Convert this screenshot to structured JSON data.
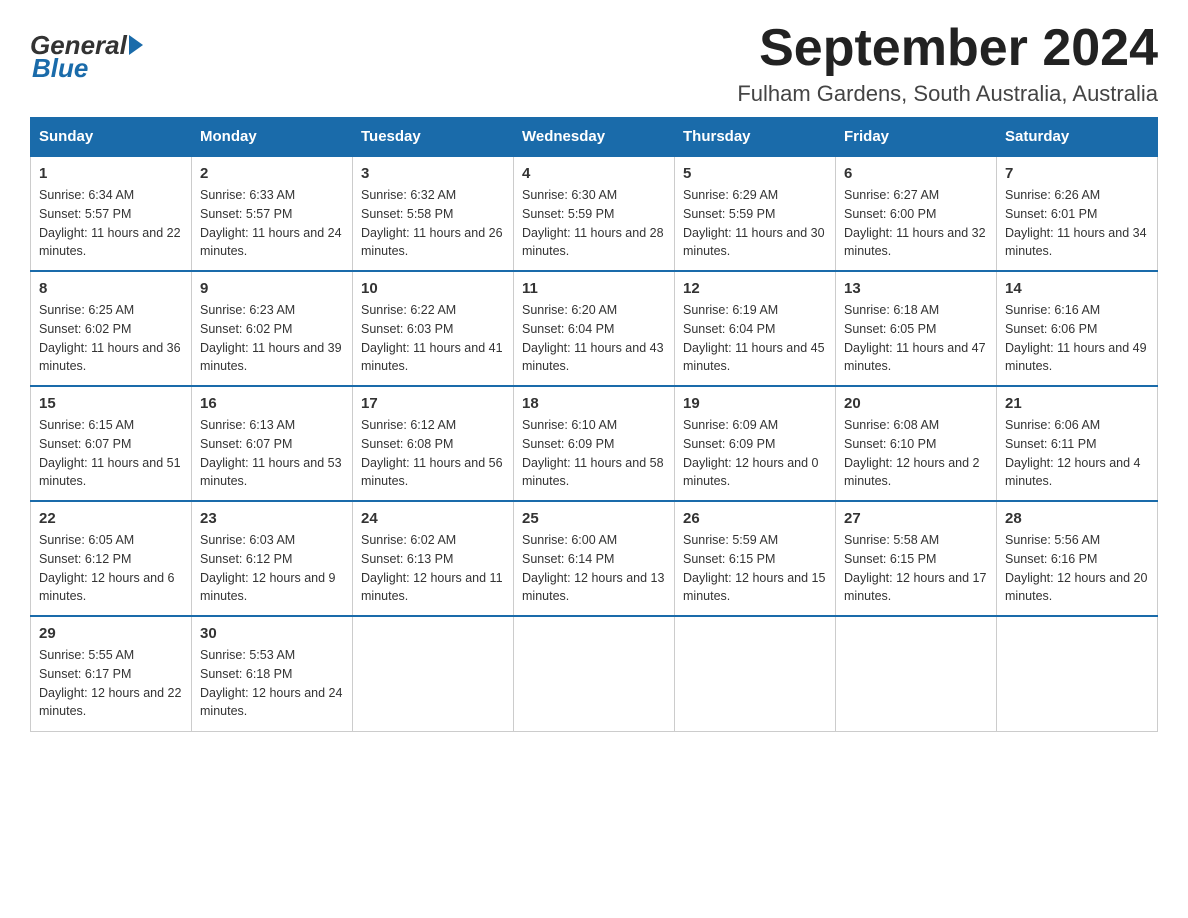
{
  "header": {
    "logo": {
      "general": "General",
      "blue": "Blue"
    },
    "month_title": "September 2024",
    "location": "Fulham Gardens, South Australia, Australia"
  },
  "days_of_week": [
    "Sunday",
    "Monday",
    "Tuesday",
    "Wednesday",
    "Thursday",
    "Friday",
    "Saturday"
  ],
  "weeks": [
    [
      {
        "day": "1",
        "sunrise": "6:34 AM",
        "sunset": "5:57 PM",
        "daylight": "11 hours and 22 minutes."
      },
      {
        "day": "2",
        "sunrise": "6:33 AM",
        "sunset": "5:57 PM",
        "daylight": "11 hours and 24 minutes."
      },
      {
        "day": "3",
        "sunrise": "6:32 AM",
        "sunset": "5:58 PM",
        "daylight": "11 hours and 26 minutes."
      },
      {
        "day": "4",
        "sunrise": "6:30 AM",
        "sunset": "5:59 PM",
        "daylight": "11 hours and 28 minutes."
      },
      {
        "day": "5",
        "sunrise": "6:29 AM",
        "sunset": "5:59 PM",
        "daylight": "11 hours and 30 minutes."
      },
      {
        "day": "6",
        "sunrise": "6:27 AM",
        "sunset": "6:00 PM",
        "daylight": "11 hours and 32 minutes."
      },
      {
        "day": "7",
        "sunrise": "6:26 AM",
        "sunset": "6:01 PM",
        "daylight": "11 hours and 34 minutes."
      }
    ],
    [
      {
        "day": "8",
        "sunrise": "6:25 AM",
        "sunset": "6:02 PM",
        "daylight": "11 hours and 36 minutes."
      },
      {
        "day": "9",
        "sunrise": "6:23 AM",
        "sunset": "6:02 PM",
        "daylight": "11 hours and 39 minutes."
      },
      {
        "day": "10",
        "sunrise": "6:22 AM",
        "sunset": "6:03 PM",
        "daylight": "11 hours and 41 minutes."
      },
      {
        "day": "11",
        "sunrise": "6:20 AM",
        "sunset": "6:04 PM",
        "daylight": "11 hours and 43 minutes."
      },
      {
        "day": "12",
        "sunrise": "6:19 AM",
        "sunset": "6:04 PM",
        "daylight": "11 hours and 45 minutes."
      },
      {
        "day": "13",
        "sunrise": "6:18 AM",
        "sunset": "6:05 PM",
        "daylight": "11 hours and 47 minutes."
      },
      {
        "day": "14",
        "sunrise": "6:16 AM",
        "sunset": "6:06 PM",
        "daylight": "11 hours and 49 minutes."
      }
    ],
    [
      {
        "day": "15",
        "sunrise": "6:15 AM",
        "sunset": "6:07 PM",
        "daylight": "11 hours and 51 minutes."
      },
      {
        "day": "16",
        "sunrise": "6:13 AM",
        "sunset": "6:07 PM",
        "daylight": "11 hours and 53 minutes."
      },
      {
        "day": "17",
        "sunrise": "6:12 AM",
        "sunset": "6:08 PM",
        "daylight": "11 hours and 56 minutes."
      },
      {
        "day": "18",
        "sunrise": "6:10 AM",
        "sunset": "6:09 PM",
        "daylight": "11 hours and 58 minutes."
      },
      {
        "day": "19",
        "sunrise": "6:09 AM",
        "sunset": "6:09 PM",
        "daylight": "12 hours and 0 minutes."
      },
      {
        "day": "20",
        "sunrise": "6:08 AM",
        "sunset": "6:10 PM",
        "daylight": "12 hours and 2 minutes."
      },
      {
        "day": "21",
        "sunrise": "6:06 AM",
        "sunset": "6:11 PM",
        "daylight": "12 hours and 4 minutes."
      }
    ],
    [
      {
        "day": "22",
        "sunrise": "6:05 AM",
        "sunset": "6:12 PM",
        "daylight": "12 hours and 6 minutes."
      },
      {
        "day": "23",
        "sunrise": "6:03 AM",
        "sunset": "6:12 PM",
        "daylight": "12 hours and 9 minutes."
      },
      {
        "day": "24",
        "sunrise": "6:02 AM",
        "sunset": "6:13 PM",
        "daylight": "12 hours and 11 minutes."
      },
      {
        "day": "25",
        "sunrise": "6:00 AM",
        "sunset": "6:14 PM",
        "daylight": "12 hours and 13 minutes."
      },
      {
        "day": "26",
        "sunrise": "5:59 AM",
        "sunset": "6:15 PM",
        "daylight": "12 hours and 15 minutes."
      },
      {
        "day": "27",
        "sunrise": "5:58 AM",
        "sunset": "6:15 PM",
        "daylight": "12 hours and 17 minutes."
      },
      {
        "day": "28",
        "sunrise": "5:56 AM",
        "sunset": "6:16 PM",
        "daylight": "12 hours and 20 minutes."
      }
    ],
    [
      {
        "day": "29",
        "sunrise": "5:55 AM",
        "sunset": "6:17 PM",
        "daylight": "12 hours and 22 minutes."
      },
      {
        "day": "30",
        "sunrise": "5:53 AM",
        "sunset": "6:18 PM",
        "daylight": "12 hours and 24 minutes."
      },
      null,
      null,
      null,
      null,
      null
    ]
  ],
  "labels": {
    "sunrise": "Sunrise:",
    "sunset": "Sunset:",
    "daylight": "Daylight:"
  }
}
